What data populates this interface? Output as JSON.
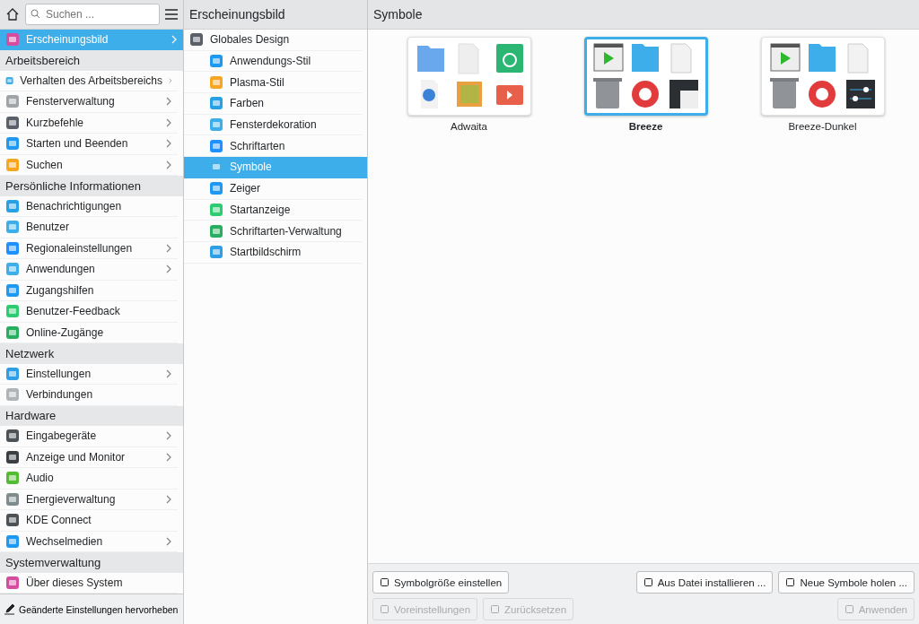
{
  "sidebar": {
    "search": {
      "placeholder": "Suchen ..."
    },
    "top_item": {
      "label": "Erscheinungsbild",
      "selected": true,
      "has_children": true
    },
    "sections": [
      {
        "title": "Arbeitsbereich",
        "items": [
          {
            "label": "Verhalten des Arbeitsbereichs",
            "selected": false,
            "has_children": true
          },
          {
            "label": "Fensterverwaltung",
            "selected": false,
            "has_children": true
          },
          {
            "label": "Kurzbefehle",
            "selected": false,
            "has_children": true
          },
          {
            "label": "Starten und Beenden",
            "selected": false,
            "has_children": true
          },
          {
            "label": "Suchen",
            "selected": false,
            "has_children": true
          }
        ]
      },
      {
        "title": "Persönliche Informationen",
        "items": [
          {
            "label": "Benachrichtigungen",
            "selected": false,
            "has_children": false
          },
          {
            "label": "Benutzer",
            "selected": false,
            "has_children": false
          },
          {
            "label": "Regionaleinstellungen",
            "selected": false,
            "has_children": true
          },
          {
            "label": "Anwendungen",
            "selected": false,
            "has_children": true
          },
          {
            "label": "Zugangshilfen",
            "selected": false,
            "has_children": false
          },
          {
            "label": "Benutzer-Feedback",
            "selected": false,
            "has_children": false
          },
          {
            "label": "Online-Zugänge",
            "selected": false,
            "has_children": false
          }
        ]
      },
      {
        "title": "Netzwerk",
        "items": [
          {
            "label": "Einstellungen",
            "selected": false,
            "has_children": true
          },
          {
            "label": "Verbindungen",
            "selected": false,
            "has_children": false
          }
        ]
      },
      {
        "title": "Hardware",
        "items": [
          {
            "label": "Eingabegeräte",
            "selected": false,
            "has_children": true
          },
          {
            "label": "Anzeige und Monitor",
            "selected": false,
            "has_children": true
          },
          {
            "label": "Audio",
            "selected": false,
            "has_children": false
          },
          {
            "label": "Energieverwaltung",
            "selected": false,
            "has_children": true
          },
          {
            "label": "KDE Connect",
            "selected": false,
            "has_children": false
          },
          {
            "label": "Wechselmedien",
            "selected": false,
            "has_children": true
          }
        ]
      },
      {
        "title": "Systemverwaltung",
        "items": [
          {
            "label": "Über dieses System",
            "selected": false,
            "has_children": false
          }
        ]
      }
    ],
    "footer": "Geänderte Einstellungen hervorheben"
  },
  "category": {
    "title": "Erscheinungsbild",
    "items": [
      {
        "label": "Globales Design",
        "selected": false,
        "children": [
          {
            "label": "Anwendungs-Stil",
            "selected": false
          },
          {
            "label": "Plasma-Stil",
            "selected": false
          },
          {
            "label": "Farben",
            "selected": false
          },
          {
            "label": "Fensterdekoration",
            "selected": false
          },
          {
            "label": "Schriftarten",
            "selected": false
          },
          {
            "label": "Symbole",
            "selected": true
          },
          {
            "label": "Zeiger",
            "selected": false
          },
          {
            "label": "Startanzeige",
            "selected": false
          },
          {
            "label": "Schriftarten-Verwaltung",
            "selected": false
          },
          {
            "label": "Startbildschirm",
            "selected": false
          }
        ]
      }
    ]
  },
  "page": {
    "title": "Symbole",
    "themes": [
      {
        "name": "Adwaita",
        "kind": "adwaita",
        "selected": false
      },
      {
        "name": "Breeze",
        "kind": "breeze",
        "selected": true
      },
      {
        "name": "Breeze-Dunkel",
        "kind": "breeze-dark",
        "selected": false
      }
    ],
    "buttons_row1_left": [
      {
        "label": "Symbolgröße einstellen",
        "disabled": false
      }
    ],
    "buttons_row1_right": [
      {
        "label": "Aus Datei installieren ...",
        "disabled": false
      },
      {
        "label": "Neue Symbole holen ...",
        "disabled": false
      }
    ],
    "buttons_row2_left": [
      {
        "label": "Voreinstellungen",
        "disabled": true
      },
      {
        "label": "Zurücksetzen",
        "disabled": true
      }
    ],
    "buttons_row2_right": [
      {
        "label": "Anwenden",
        "disabled": true
      }
    ]
  }
}
